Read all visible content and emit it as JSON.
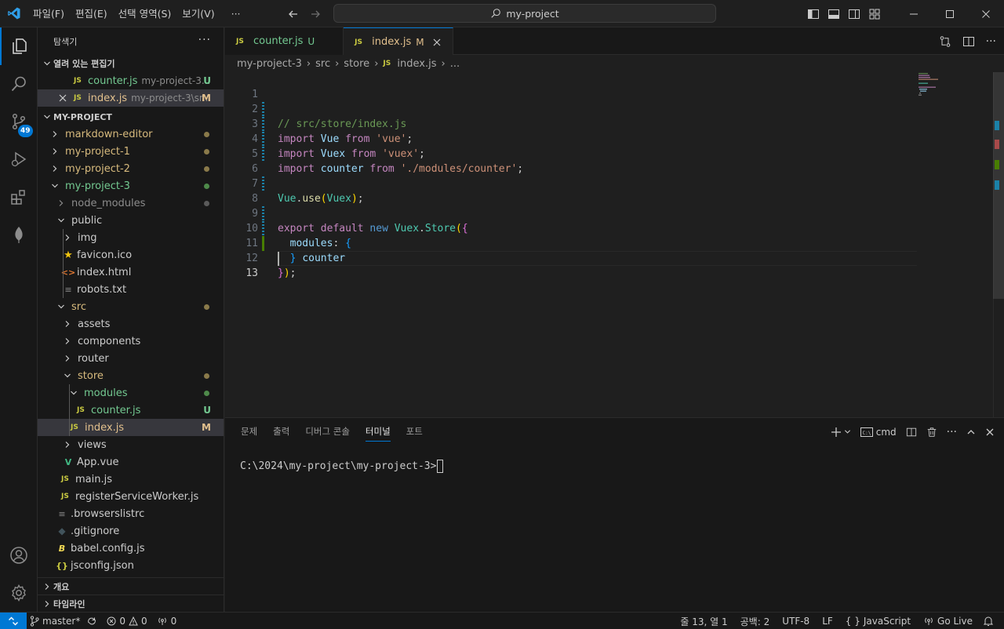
{
  "titlebar": {
    "menu": [
      "파일(F)",
      "편집(E)",
      "선택 영역(S)",
      "보기(V)",
      "···"
    ],
    "search_text": "my-project"
  },
  "activity": {
    "scm_badge": "49"
  },
  "explorer": {
    "header": "탐색기",
    "open_editors_title": "열려 있는 편집기",
    "open_editors": [
      {
        "name": "counter.js",
        "desc": "my-project-3...",
        "status": "U"
      },
      {
        "name": "index.js",
        "desc": "my-project-3\\sr...",
        "status": "M"
      }
    ],
    "project_title": "MY-PROJECT",
    "tree": [
      {
        "label": "markdown-editor"
      },
      {
        "label": "my-project-1"
      },
      {
        "label": "my-project-2"
      },
      {
        "label": "my-project-3"
      },
      {
        "label": "node_modules"
      },
      {
        "label": "public"
      },
      {
        "label": "img"
      },
      {
        "label": "favicon.ico"
      },
      {
        "label": "index.html"
      },
      {
        "label": "robots.txt"
      },
      {
        "label": "src"
      },
      {
        "label": "assets"
      },
      {
        "label": "components"
      },
      {
        "label": "router"
      },
      {
        "label": "store"
      },
      {
        "label": "modules"
      },
      {
        "label": "counter.js",
        "status": "U"
      },
      {
        "label": "index.js",
        "status": "M"
      },
      {
        "label": "views"
      },
      {
        "label": "App.vue"
      },
      {
        "label": "main.js"
      },
      {
        "label": "registerServiceWorker.js"
      },
      {
        "label": ".browserslistrc"
      },
      {
        "label": ".gitignore"
      },
      {
        "label": "babel.config.js"
      },
      {
        "label": "jsconfig.json"
      }
    ],
    "outline_title": "개요",
    "timeline_title": "타임라인"
  },
  "tabs": [
    {
      "name": "counter.js",
      "flag": "U"
    },
    {
      "name": "index.js",
      "flag": "M"
    }
  ],
  "breadcrumb": [
    "my-project-3",
    "src",
    "store",
    "index.js",
    "..."
  ],
  "editor": {
    "line_numbers": [
      "1",
      "2",
      "3",
      "4",
      "5",
      "6",
      "7",
      "8",
      "9",
      "10",
      "11",
      "12",
      "13"
    ],
    "current_line": 13
  },
  "panel": {
    "tabs": [
      "문제",
      "출력",
      "디버그 콘솔",
      "터미널",
      "포트"
    ],
    "active_tab": "터미널",
    "terminal_name": "cmd",
    "prompt": "C:\\2024\\my-project\\my-project-3>"
  },
  "statusbar": {
    "branch": "master*",
    "errors": "0",
    "warnings": "0",
    "ports": "0",
    "position": "줄 13, 열 1",
    "indent": "공백: 2",
    "encoding": "UTF-8",
    "eol": "LF",
    "language": "JavaScript",
    "live": "Go Live"
  },
  "colors": {
    "accent": "#0078d4",
    "untracked": "#73c991",
    "modified": "#e2c08d"
  }
}
